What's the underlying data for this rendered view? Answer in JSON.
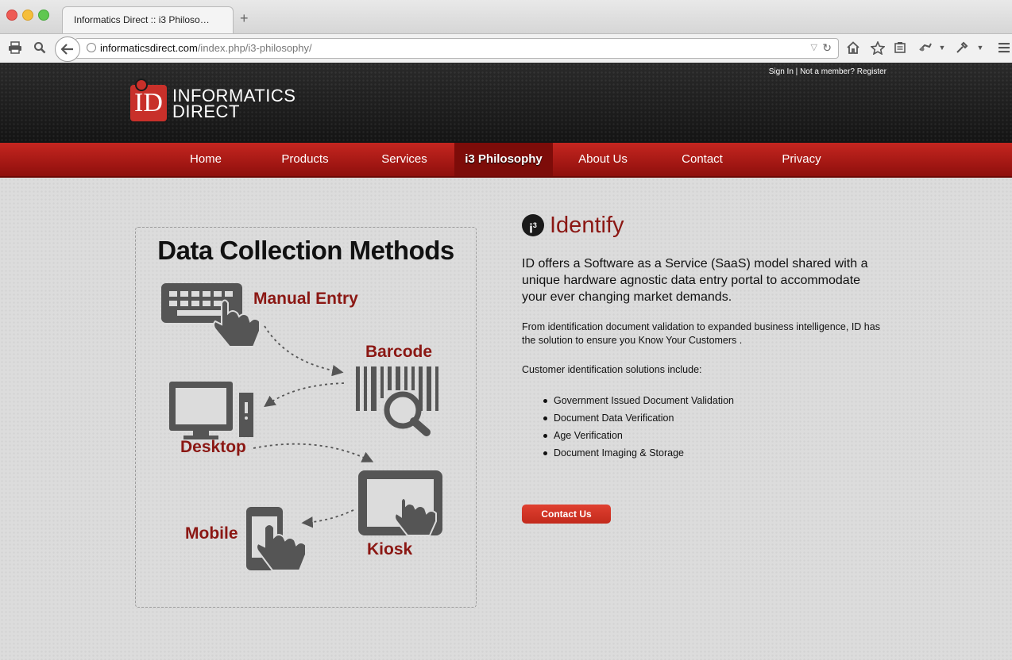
{
  "browser": {
    "tab_title": "Informatics Direct :: i3 Philoso…",
    "url_host": "informaticsdirect.com",
    "url_path": "/index.php/i3-philosophy/"
  },
  "header": {
    "logo_text_1": "INFORMATICS",
    "logo_text_2": "DIRECT",
    "logo_mark": "ID",
    "sign_in": "Sign In",
    "separator": " | ",
    "register": "Not a member? Register"
  },
  "nav": {
    "items": [
      {
        "label": "Home"
      },
      {
        "label": "Products"
      },
      {
        "label": "Services"
      },
      {
        "label": "i3 Philosophy"
      },
      {
        "label": "About Us"
      },
      {
        "label": "Contact"
      },
      {
        "label": "Privacy"
      }
    ],
    "active": "i3 Philosophy"
  },
  "diagram": {
    "title": "Data Collection Methods",
    "manual_entry": "Manual Entry",
    "barcode": "Barcode",
    "desktop": "Desktop",
    "kiosk": "Kiosk",
    "mobile": "Mobile"
  },
  "main": {
    "icon_label": "i",
    "icon_sup": "3",
    "heading": "Identify",
    "lead": "ID offers a Software as a Service (SaaS) model shared with a unique hardware agnostic data entry portal to accommodate your ever changing market demands.",
    "paragraph1": "From identification document validation to expanded business intelligence, ID has the solution to ensure you Know Your Customers .",
    "paragraph2": "Customer identification solutions include:",
    "bullets": [
      "Government Issued Document Validation",
      "Document Data Verification",
      "Age Verification",
      "Document Imaging & Storage"
    ],
    "contact_button": "Contact Us"
  },
  "colors": {
    "accent": "#c52620",
    "label_red": "#8b1713",
    "icon_gray": "#555555"
  }
}
